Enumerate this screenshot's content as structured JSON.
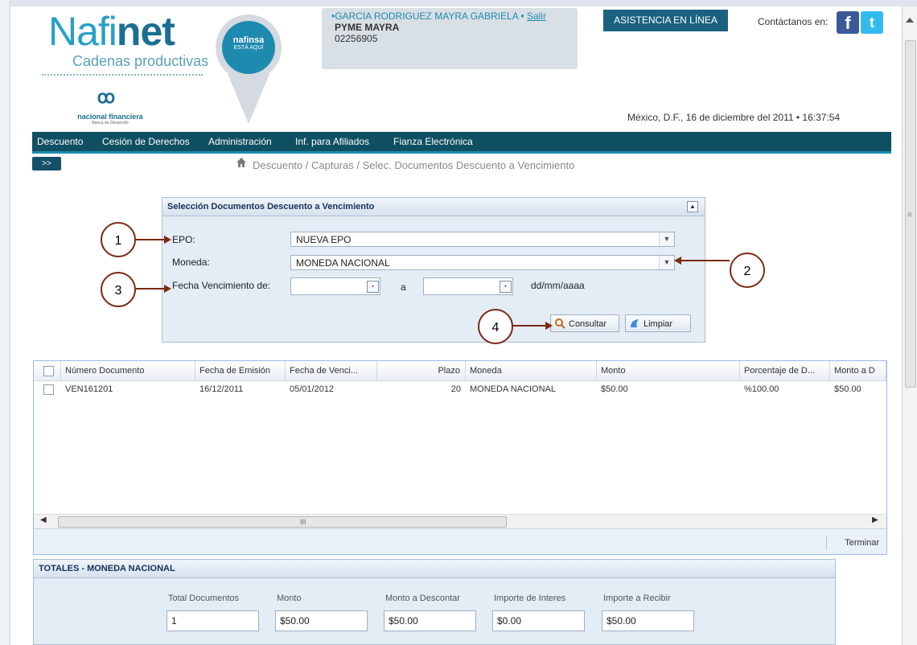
{
  "header": {
    "logo_naf": "Nafi",
    "logo_net": "net",
    "logo_sub": "Cadenas productivas",
    "badge_top": "nafinsa",
    "badge_bottom": "ESTÁ AQUÍ",
    "nf_logo_text": "nacional financiera",
    "nf_logo_sub": "Banca de Desarrollo",
    "user_name": "GARCIA RODRIGUEZ MAYRA GABRIELA",
    "logout": "Salir",
    "company": "PYME MAYRA",
    "user_id": "02256905",
    "assist_button": "ASISTENCIA EN LÍNEA",
    "contact_label": "Contáctanos en:",
    "datetime": "México, D.F., 16 de diciembre del 2011 • 16:37:54"
  },
  "nav": {
    "items": [
      "Descuento",
      "Cesión de Derechos",
      "Administración",
      "Inf. para Afiliados",
      "Fianza Electrónica"
    ],
    "expand": ">>"
  },
  "breadcrumb": "Descuento / Capturas / Selec. Documentos Descuento a Vencimiento",
  "form": {
    "title": "Selección Documentos Descuento a Vencimiento",
    "epo_label": "EPO:",
    "epo_value": "NUEVA EPO",
    "moneda_label": "Moneda:",
    "moneda_value": "MONEDA NACIONAL",
    "fecha_label": "Fecha Vencimiento de:",
    "a_label": "a",
    "date_format": "dd/mm/aaaa",
    "consultar": "Consultar",
    "limpiar": "Limpiar"
  },
  "callouts": [
    "1",
    "2",
    "3",
    "4"
  ],
  "grid": {
    "columns": [
      "Número Documento",
      "Fecha de Emisión",
      "Fecha de Venci...",
      "Plazo",
      "Moneda",
      "Monto",
      "Porcentaje de D...",
      "Monto a D"
    ],
    "rows": [
      [
        "VEN161201",
        "16/12/2011",
        "05/01/2012",
        "20",
        "MONEDA NACIONAL",
        "$50.00",
        "%100.00",
        "$50.00"
      ]
    ],
    "finish": "Terminar"
  },
  "totals": {
    "title": "TOTALES - MONEDA NACIONAL",
    "labels": [
      "Total Documentos",
      "Monto",
      "Monto a Descontar",
      "Importe de Interes",
      "Importe a Recibir"
    ],
    "values": [
      "1",
      "$50.00",
      "$50.00",
      "$0.00",
      "$50.00"
    ]
  },
  "colors": {
    "accent": "#1f8ab0",
    "nav_bg": "#0f4f62",
    "callout_border": "#7a2a12"
  }
}
